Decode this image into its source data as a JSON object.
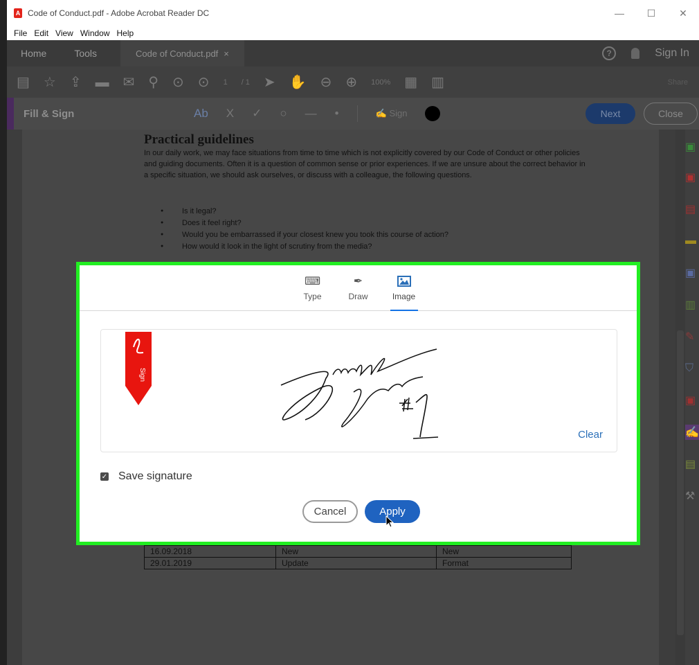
{
  "window": {
    "title": "Code of Conduct.pdf - Adobe Acrobat Reader DC",
    "controls": [
      "—",
      "☐",
      "✕"
    ]
  },
  "menu": [
    "File",
    "Edit",
    "View",
    "Window",
    "Help"
  ],
  "tabs": {
    "home": "Home",
    "tools": "Tools",
    "document": "Code of Conduct.pdf",
    "document_close": "×",
    "sign_in": "Sign In",
    "help": "?"
  },
  "toolbar": {
    "page_current": "1",
    "page_total": "/ 1",
    "zoom": "100%",
    "share": "Share"
  },
  "fill_sign": {
    "label": "Fill & Sign",
    "text_tool": "Ab",
    "cross_tool": "X",
    "check_tool": "✓",
    "circle_tool": "○",
    "line_tool": "—",
    "dot_tool": "•",
    "sign_label": "Sign",
    "next": "Next",
    "close": "Close"
  },
  "document": {
    "heading": "Practical guidelines",
    "paragraph": "In our daily work, we may face situations from time to time which is not explicitly covered by our Code of Conduct or other policies and guiding documents. Often it is a question of common sense or prior experiences. If we are unsure about the correct behavior in a specific situation, we should ask ourselves, or discuss with a colleague, the following questions.",
    "bullets": [
      "Is it legal?",
      "Does it feel right?",
      "Would you be embarrassed if your closest knew you took this course of action?",
      "How would it look in the light of scrutiny from the media?"
    ],
    "table_rows": [
      [
        "16.09.2018",
        "New",
        "New"
      ],
      [
        "29.01.2019",
        "Update",
        "Format"
      ]
    ]
  },
  "dialog": {
    "tabs": [
      {
        "label": "Type",
        "icon": "keyboard-icon"
      },
      {
        "label": "Draw",
        "icon": "pen-icon"
      },
      {
        "label": "Image",
        "icon": "image-icon"
      }
    ],
    "active_tab": "Image",
    "flag_text": "Sign",
    "clear": "Clear",
    "save_signature": "Save signature",
    "save_checked": true,
    "cancel": "Cancel",
    "apply": "Apply",
    "colors": {
      "apply_bg": "#1f63c0",
      "highlight_border": "#22ee22",
      "flag_red": "#e8150f",
      "clear_link": "#2a6fb8"
    }
  }
}
